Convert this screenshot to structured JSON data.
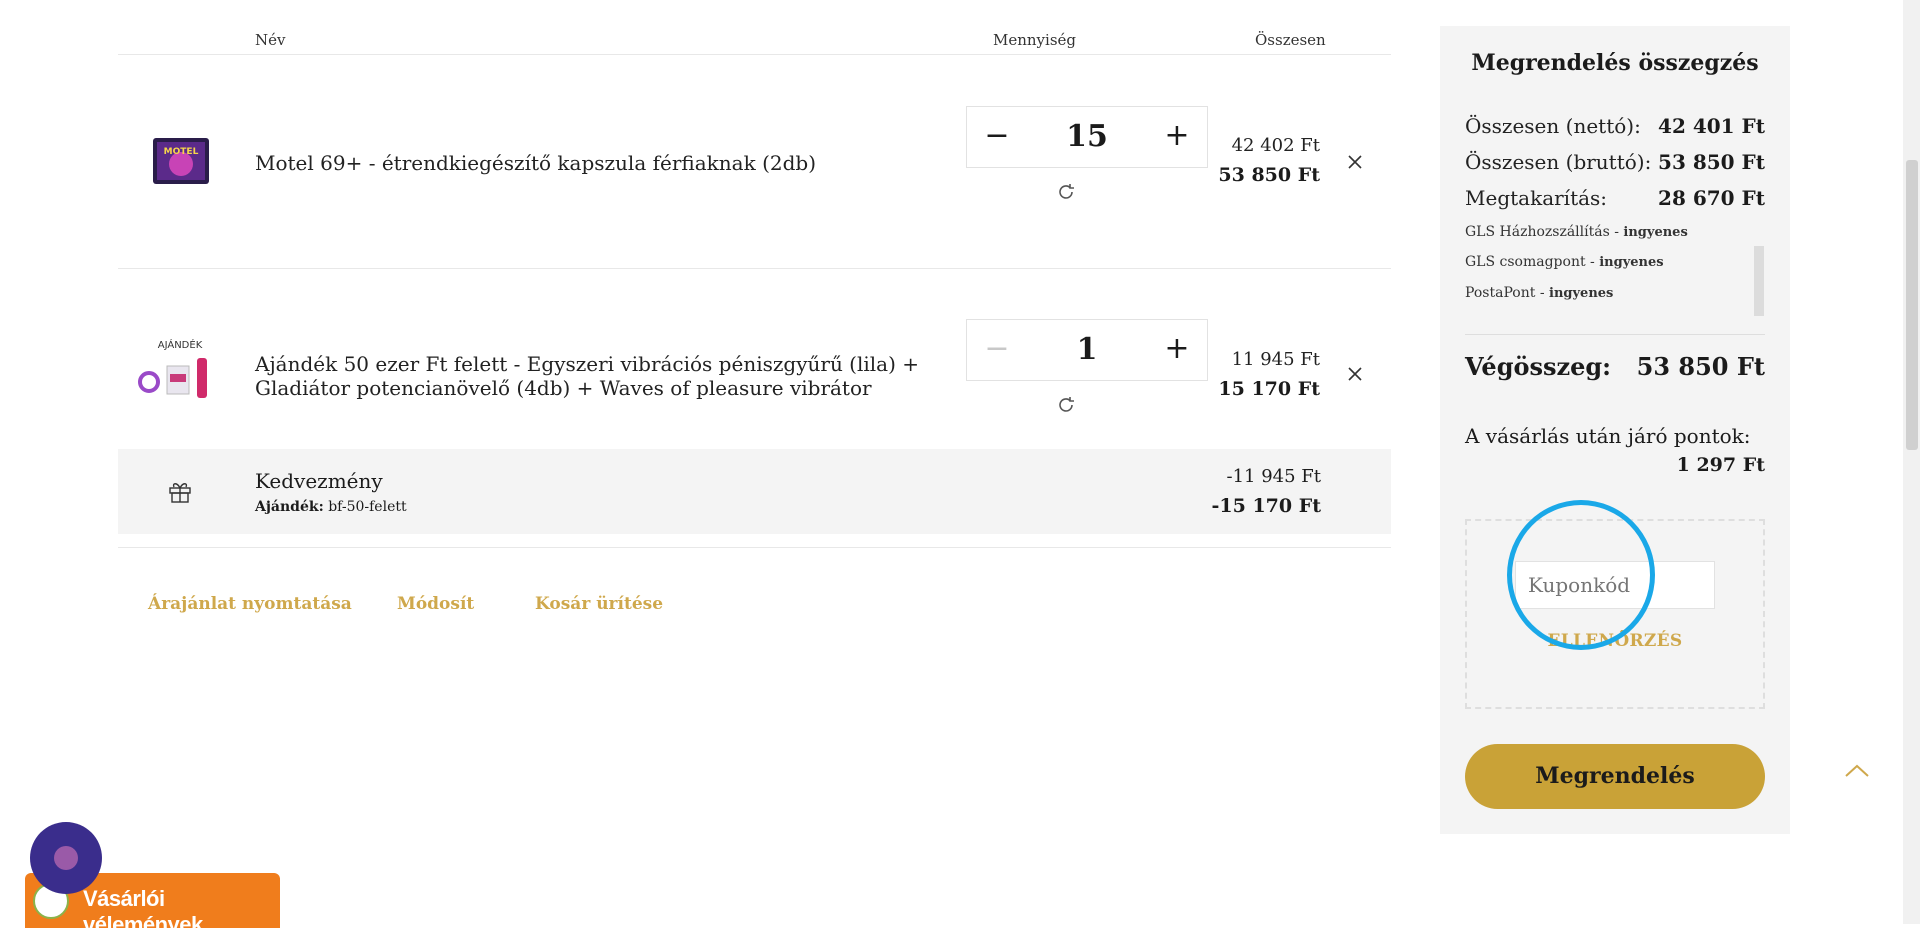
{
  "colors": {
    "accent": "#cfa84c",
    "button": "#c9a237",
    "highlight": "#1aa8e8",
    "reviews": "#f07d1c",
    "chat": "#3a2d8c"
  },
  "table": {
    "headers": {
      "name": "Név",
      "quantity": "Mennyiség",
      "total": "Összesen"
    }
  },
  "items": [
    {
      "name": "Motel 69+ - étrendkiegészítő kapszula férfiaknak (2db)",
      "quantity": "15",
      "net_price": "42 402 Ft",
      "gross_price": "53 850 Ft",
      "thumb_text": "MOTEL"
    },
    {
      "name_line1": "Ajándék 50 ezer Ft felett - Egyszeri vibrációs péniszgyűrű (lila) +",
      "name_line2": "Gladiátor potencianövelő (4db) + Waves of pleasure vibrátor",
      "quantity": "1",
      "net_price": "11 945 Ft",
      "gross_price": "15 170 Ft",
      "thumb_text": "AJÁNDÉK"
    }
  ],
  "discount": {
    "title": "Kedvezmény",
    "label": "Ajándék:",
    "code": "bf-50-felett",
    "net": "-11 945 Ft",
    "gross": "-15 170 Ft"
  },
  "actions": {
    "print": "Árajánlat nyomtatása",
    "modify": "Módosít",
    "empty": "Kosár ürítése"
  },
  "summary": {
    "title": "Megrendelés összegzés",
    "net_label": "Összesen (nettó):",
    "net_value": "42 401 Ft",
    "gross_label": "Összesen (bruttó):",
    "gross_value": "53 850 Ft",
    "savings_label": "Megtakarítás:",
    "savings_value": "28 670 Ft",
    "shipping": [
      {
        "name": "GLS Házhozszállítás",
        "price": "ingyenes"
      },
      {
        "name": "GLS csomagpont",
        "price": "ingyenes"
      },
      {
        "name": "PostaPont",
        "price": "ingyenes"
      }
    ],
    "total_label": "Végösszeg:",
    "total_value": "53 850 Ft",
    "points_label": "A vásárlás után járó pontok:",
    "points_value": "1 297 Ft",
    "coupon_placeholder": "Kuponkód",
    "coupon_check": "ELLENŐRZÉS",
    "order_button": "Megrendelés"
  },
  "widgets": {
    "reviews_label": "Vásárlói vélemények"
  }
}
